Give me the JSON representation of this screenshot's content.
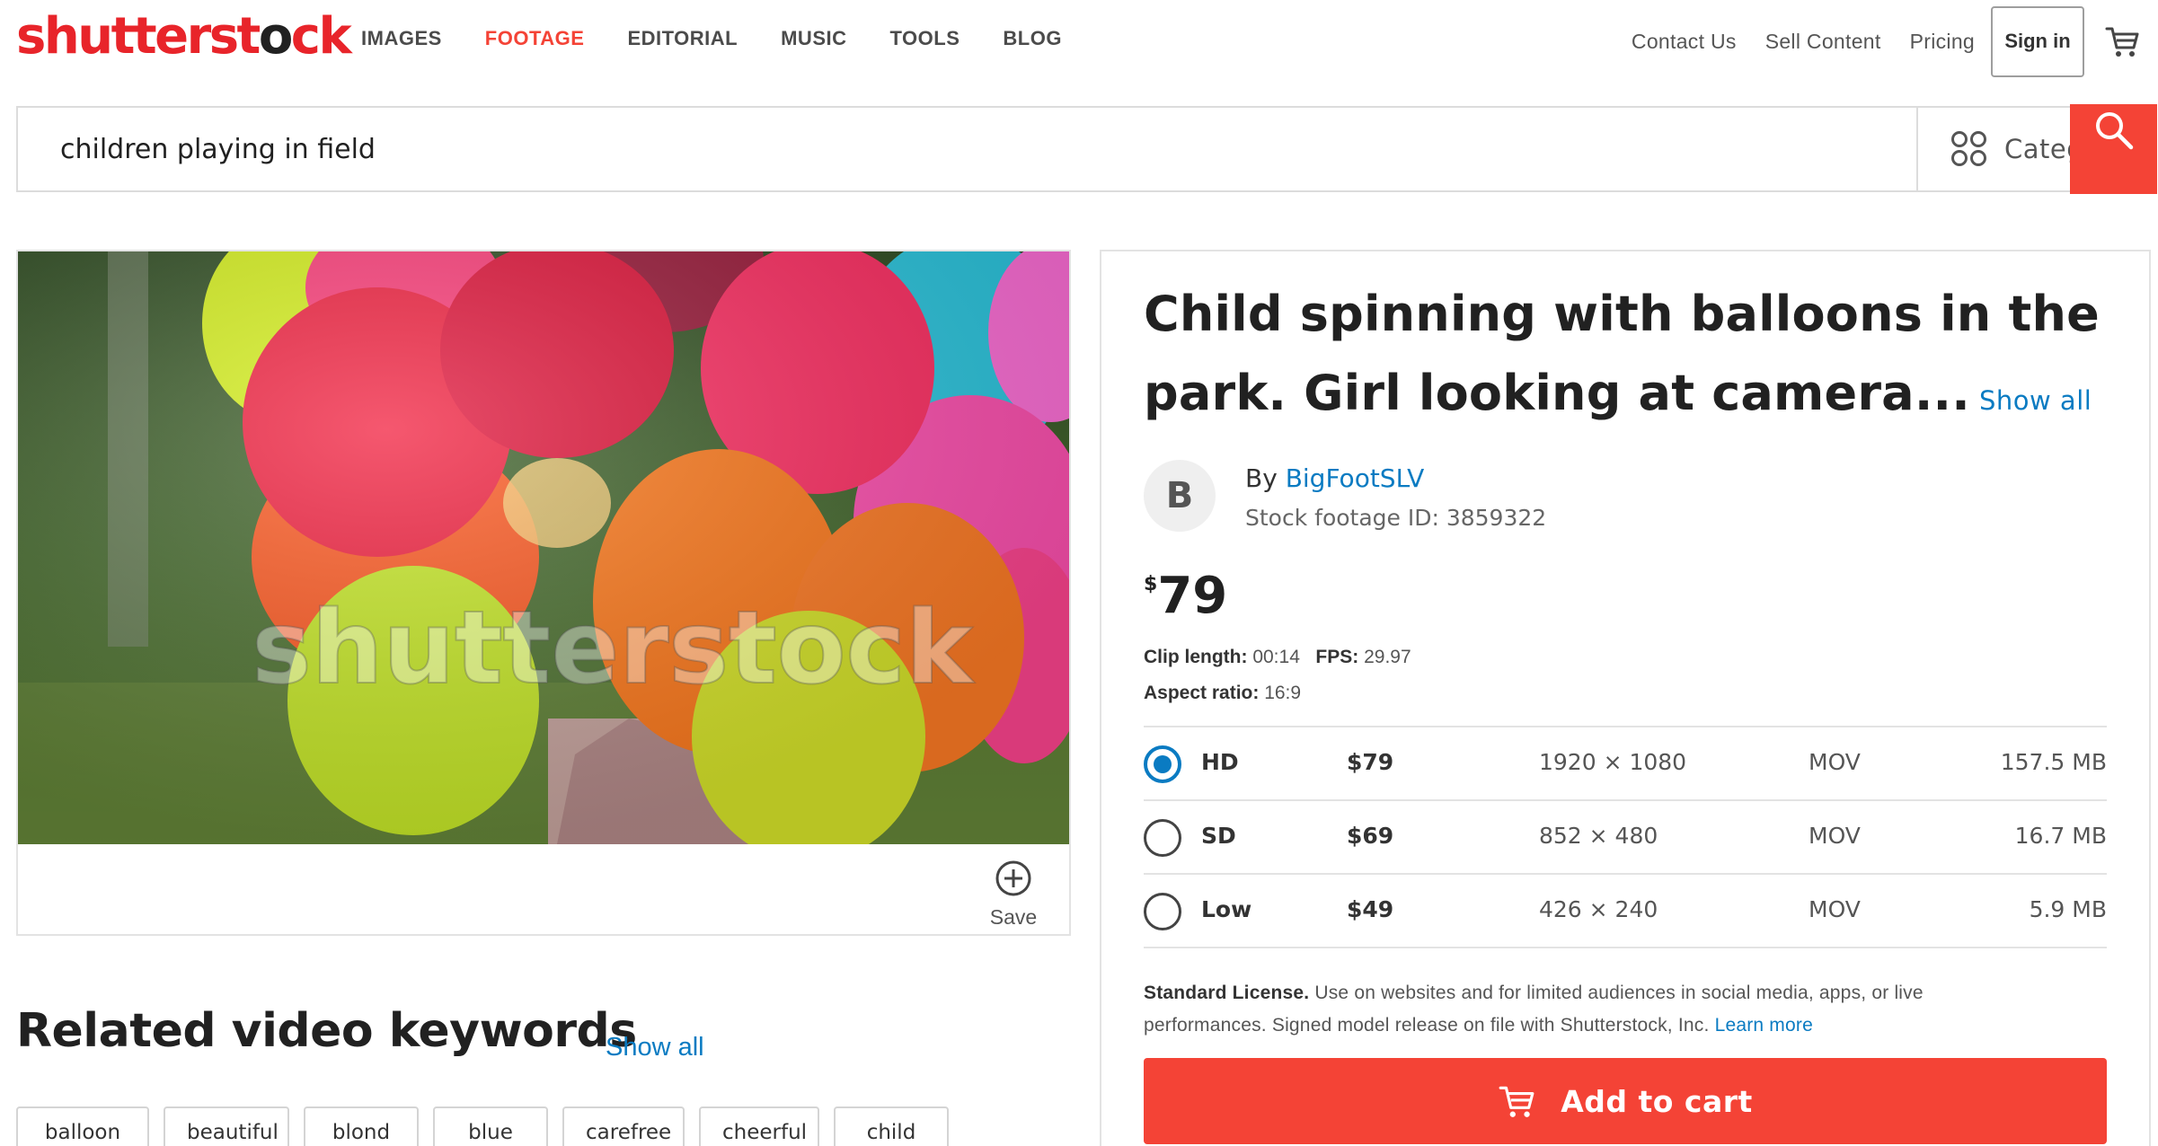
{
  "brand": {
    "logo_part1": "shutterst",
    "logo_part2": "ck",
    "accent": "#f44336"
  },
  "nav": {
    "items": [
      {
        "label": "IMAGES",
        "active": false
      },
      {
        "label": "FOOTAGE",
        "active": true
      },
      {
        "label": "EDITORIAL",
        "active": false
      },
      {
        "label": "MUSIC",
        "active": false
      },
      {
        "label": "TOOLS",
        "active": false
      },
      {
        "label": "BLOG",
        "active": false
      }
    ],
    "right": {
      "contact": "Contact Us",
      "sell": "Sell Content",
      "pricing": "Pricing",
      "signin": "Sign in",
      "cart_icon": "cart-icon"
    }
  },
  "search": {
    "value": "children playing in field",
    "categories_label": "Categories",
    "categories_icon": "grid-circles-icon",
    "search_icon": "search-icon"
  },
  "video": {
    "watermark": "shutterstock",
    "save_label": "Save",
    "save_icon": "plus-circle-icon"
  },
  "related": {
    "title": "Related video keywords",
    "show_all": "Show all",
    "keywords": [
      "balloon",
      "beautiful",
      "blond",
      "blue",
      "carefree",
      "cheerful",
      "child"
    ]
  },
  "clip": {
    "title": "Child spinning with balloons in the park. Girl looking at camera...",
    "show_all": "Show all",
    "avatar_letter": "B",
    "by_label": "By",
    "author": "BigFootSLV",
    "stock_id": "Stock footage ID: 3859322",
    "price_currency": "$",
    "price_amount": "79",
    "clip_length_label": "Clip length:",
    "clip_length": "00:14",
    "fps_label": "FPS:",
    "fps": "29.97",
    "aspect_label": "Aspect ratio:",
    "aspect": "16:9",
    "formats": [
      {
        "name": "HD",
        "price": "$79",
        "resolution": "1920 × 1080",
        "format": "MOV",
        "size": "157.5 MB",
        "selected": true
      },
      {
        "name": "SD",
        "price": "$69",
        "resolution": "852 × 480",
        "format": "MOV",
        "size": "16.7 MB",
        "selected": false
      },
      {
        "name": "Low",
        "price": "$49",
        "resolution": "426 × 240",
        "format": "MOV",
        "size": "5.9 MB",
        "selected": false
      }
    ],
    "license_title": "Standard License.",
    "license_text": "Use on websites and for limited audiences in social media, apps, or live performances. Signed model release on file with Shutterstock, Inc.",
    "learn_more": "Learn more",
    "add_to_cart": "Add to cart"
  }
}
